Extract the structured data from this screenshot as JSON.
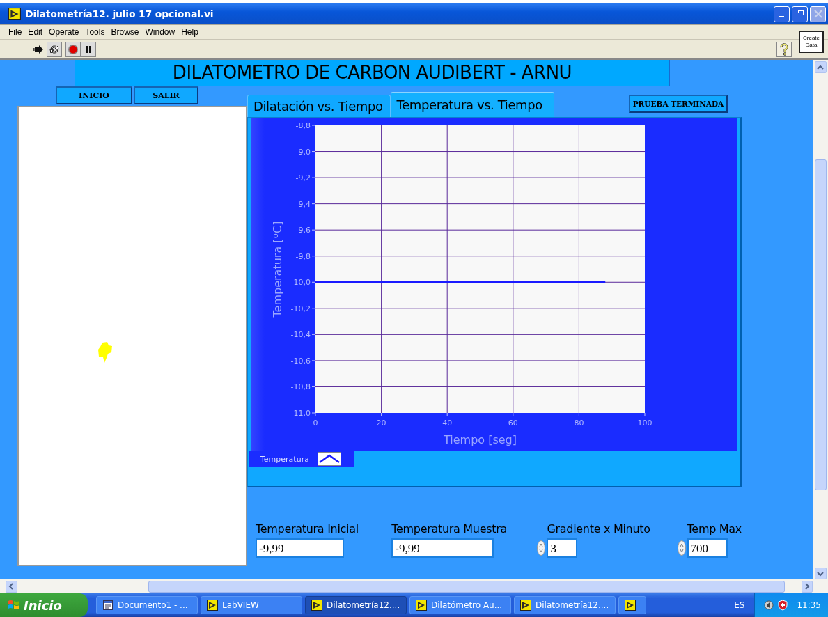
{
  "window": {
    "title": "Dilatometría12. julio 17 opcional.vi"
  },
  "menu": [
    "File",
    "Edit",
    "Operate",
    "Tools",
    "Browse",
    "Window",
    "Help"
  ],
  "create_data": "Create Data",
  "panel": {
    "heading": "DILATOMETRO DE CARBON AUDIBERT - ARNU",
    "buttons": [
      "INICIO",
      "SALIR"
    ],
    "status_button": "PRUEBA TERMINADA",
    "tabs": [
      {
        "label": "Dilatación vs. Tiempo",
        "selected": false
      },
      {
        "label": "Temperatura vs. Tiempo",
        "selected": true
      }
    ],
    "chart_data": {
      "type": "line",
      "grid": true,
      "xlabel": "Tiempo [seg]",
      "ylabel": "Temperatura [ºC]",
      "xlim": [
        0,
        100
      ],
      "ylim": [
        -11,
        -8.8
      ],
      "xticks": [
        0,
        20,
        40,
        60,
        80,
        100
      ],
      "yticks": [
        {
          "value": -8.8,
          "label": "-8,8"
        },
        {
          "value": -9.0,
          "label": "-9,0"
        },
        {
          "value": -9.2,
          "label": "-9,2"
        },
        {
          "value": -9.4,
          "label": "-9,4"
        },
        {
          "value": -9.6,
          "label": "-9,6"
        },
        {
          "value": -9.8,
          "label": "-9,8"
        },
        {
          "value": -10.0,
          "label": "-10,0"
        },
        {
          "value": -10.2,
          "label": "-10,2"
        },
        {
          "value": -10.4,
          "label": "-10,4"
        },
        {
          "value": -10.6,
          "label": "-10,6"
        },
        {
          "value": -10.8,
          "label": "-10,8"
        },
        {
          "value": -11.0,
          "label": "-11,0"
        }
      ],
      "x": [
        0,
        88
      ],
      "series": [
        {
          "name": "Temperatura",
          "color": "#1a1aff",
          "values": [
            -10.0,
            -10.0
          ]
        }
      ]
    },
    "fields": [
      {
        "kind": "numeric",
        "label": "Temperatura Inicial",
        "value": "-9,99"
      },
      {
        "kind": "numeric",
        "label": "Temperatura Muestra",
        "value": "-9,99"
      },
      {
        "kind": "spinner",
        "label": "Gradiente x Minuto",
        "value": "3"
      },
      {
        "kind": "spinner",
        "label": "Temp Max",
        "value": "700"
      }
    ]
  },
  "taskbar": {
    "start": "Inicio",
    "items": [
      {
        "kind": "doc",
        "label": "Documento1 - ...",
        "selected": false
      },
      {
        "kind": "vi",
        "label": "LabVIEW",
        "selected": false
      },
      {
        "kind": "vi",
        "label": "Dilatometría12....",
        "selected": true
      },
      {
        "kind": "vi",
        "label": "Dilatómetro Au...",
        "selected": false
      },
      {
        "kind": "vi",
        "label": "Dilatometría12....",
        "selected": false
      },
      {
        "kind": "vi-only",
        "selected": false
      }
    ],
    "language": "ES",
    "clock": "11:35"
  }
}
